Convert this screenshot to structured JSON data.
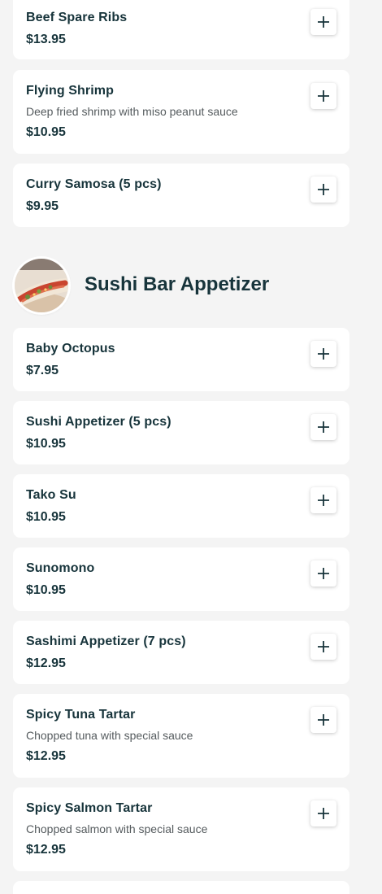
{
  "menu": {
    "items_before": [
      {
        "name": "Beef Spare Ribs",
        "price": "$13.95"
      },
      {
        "name": "Flying Shrimp",
        "description": "Deep fried shrimp with miso peanut sauce",
        "price": "$10.95"
      },
      {
        "name": "Curry Samosa (5 pcs)",
        "price": "$9.95"
      }
    ],
    "category": {
      "title": "Sushi Bar Appetizer",
      "image_icon": "sushi-dish-photo"
    },
    "items": [
      {
        "name": "Baby Octopus",
        "price": "$7.95"
      },
      {
        "name": "Sushi Appetizer (5 pcs)",
        "price": "$10.95"
      },
      {
        "name": "Tako Su",
        "price": "$10.95"
      },
      {
        "name": "Sunomono",
        "price": "$10.95"
      },
      {
        "name": "Sashimi Appetizer (7 pcs)",
        "price": "$12.95"
      },
      {
        "name": "Spicy Tuna Tartar",
        "description": "Chopped tuna with special sauce",
        "price": "$12.95"
      },
      {
        "name": "Spicy Salmon Tartar",
        "description": "Chopped salmon with special sauce",
        "price": "$12.95"
      }
    ]
  },
  "add_icon": "plus-icon",
  "colors": {
    "background": "#f4f4f4",
    "card": "#ffffff",
    "text_primary": "#17343b",
    "text_secondary": "#555b5e"
  }
}
